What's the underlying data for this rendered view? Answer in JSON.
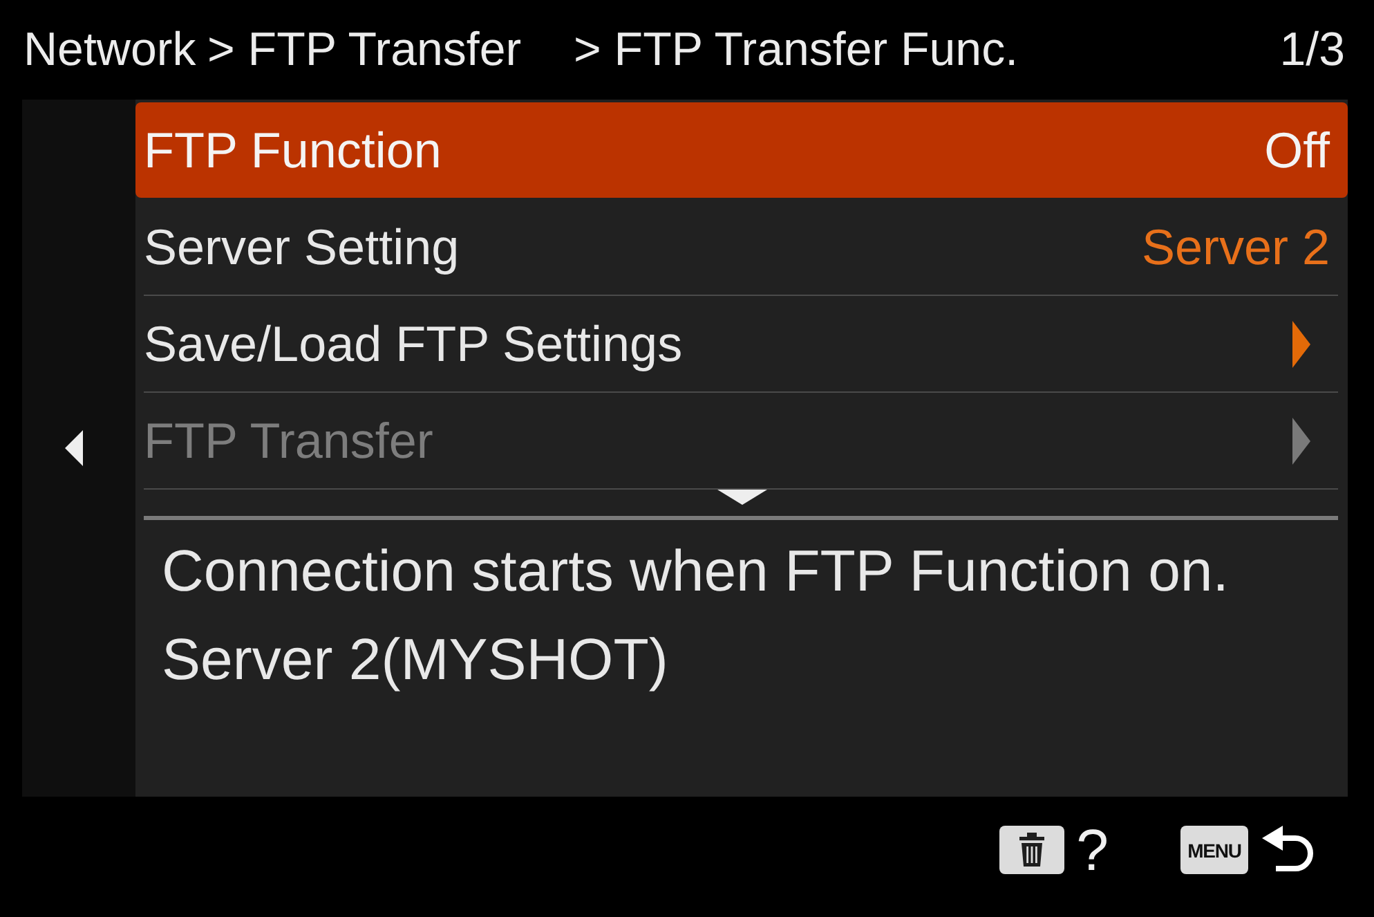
{
  "header": {
    "breadcrumb": [
      "Network",
      "> FTP Transfer",
      "> FTP Transfer Func."
    ],
    "page": "1/3"
  },
  "menu": {
    "rows": [
      {
        "kind": "value",
        "label": "FTP Function",
        "value": "Off",
        "selected": true,
        "disabled": false
      },
      {
        "kind": "value",
        "label": "Server Setting",
        "value": "Server 2",
        "selected": false,
        "disabled": false
      },
      {
        "kind": "submenu",
        "label": "Save/Load FTP Settings",
        "selected": false,
        "disabled": false
      },
      {
        "kind": "submenu",
        "label": "FTP Transfer",
        "selected": false,
        "disabled": true
      }
    ]
  },
  "description": [
    "Connection starts when FTP Function on.",
    "Server 2(MYSHOT)"
  ],
  "footer": [
    {
      "kind": "trash-key",
      "text": "?"
    },
    {
      "kind": "menu-key",
      "key": "MENU"
    }
  ]
}
